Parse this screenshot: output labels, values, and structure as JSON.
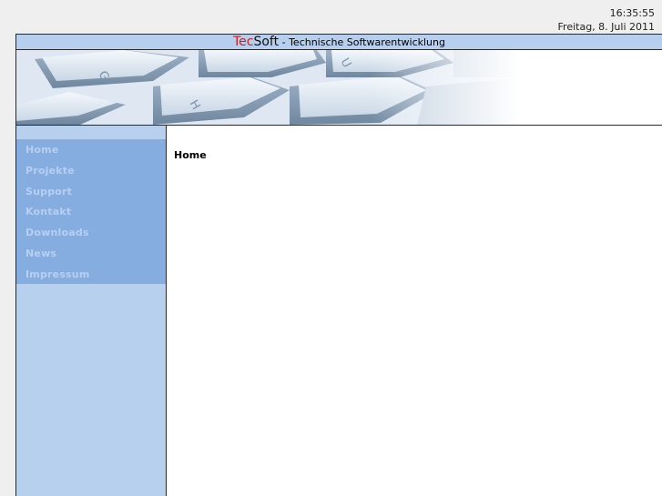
{
  "clock": {
    "time": "16:35:55",
    "date": "Freitag, 8. Juli 2011"
  },
  "header": {
    "brand_part1": "Tec",
    "brand_part2": "Soft",
    "tagline": " - Technische Softwarentwicklung"
  },
  "colors": {
    "accent_red": "#d41c1c",
    "sidebar_light": "#b6d0ee",
    "sidebar_nav": "#85ade0",
    "nav_text": "#b7cff0"
  },
  "sidebar": {
    "items": [
      {
        "label": "Home"
      },
      {
        "label": "Projekte"
      },
      {
        "label": "Support"
      },
      {
        "label": "Kontakt"
      },
      {
        "label": "Downloads"
      },
      {
        "label": "News"
      },
      {
        "label": "Impressum"
      }
    ]
  },
  "main": {
    "title": "Home"
  },
  "banner": {
    "key_letters": [
      "G",
      "H",
      "U"
    ]
  }
}
